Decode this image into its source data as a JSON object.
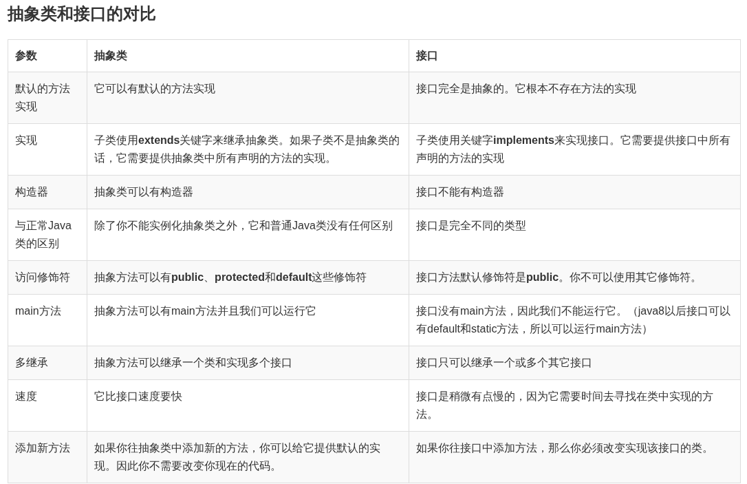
{
  "title": "抽象类和接口的对比",
  "table": {
    "columns": [
      "参数",
      "抽象类",
      "接口"
    ],
    "rows": [
      [
        "默认的方法实现",
        "它可以有默认的方法实现",
        "接口完全是抽象的。它根本不存在方法的实现"
      ],
      [
        "实现",
        "子类使用**extends**关键字来继承抽象类。如果子类不是抽象类的话，它需要提供抽象类中所有声明的方法的实现。",
        "子类使用关键字**implements**来实现接口。它需要提供接口中所有声明的方法的实现"
      ],
      [
        "构造器",
        "抽象类可以有构造器",
        "接口不能有构造器"
      ],
      [
        "与正常Java类的区别",
        "除了你不能实例化抽象类之外，它和普通Java类没有任何区别",
        "接口是完全不同的类型"
      ],
      [
        "访问修饰符",
        "抽象方法可以有**public**、**protected**和**default**这些修饰符",
        "接口方法默认修饰符是**public**。你不可以使用其它修饰符。"
      ],
      [
        "main方法",
        "抽象方法可以有main方法并且我们可以运行它",
        "接口没有main方法，因此我们不能运行它。（java8以后接口可以有default和static方法，所以可以运行main方法）"
      ],
      [
        "多继承",
        "抽象方法可以继承一个类和实现多个接口",
        "接口只可以继承一个或多个其它接口"
      ],
      [
        "速度",
        "它比接口速度要快",
        "接口是稍微有点慢的，因为它需要时间去寻找在类中实现的方法。"
      ],
      [
        "添加新方法",
        "如果你往抽象类中添加新的方法，你可以给它提供默认的实现。因此你不需要改变你现在的代码。",
        "如果你往接口中添加方法，那么你必须改变实现该接口的类。"
      ]
    ]
  }
}
